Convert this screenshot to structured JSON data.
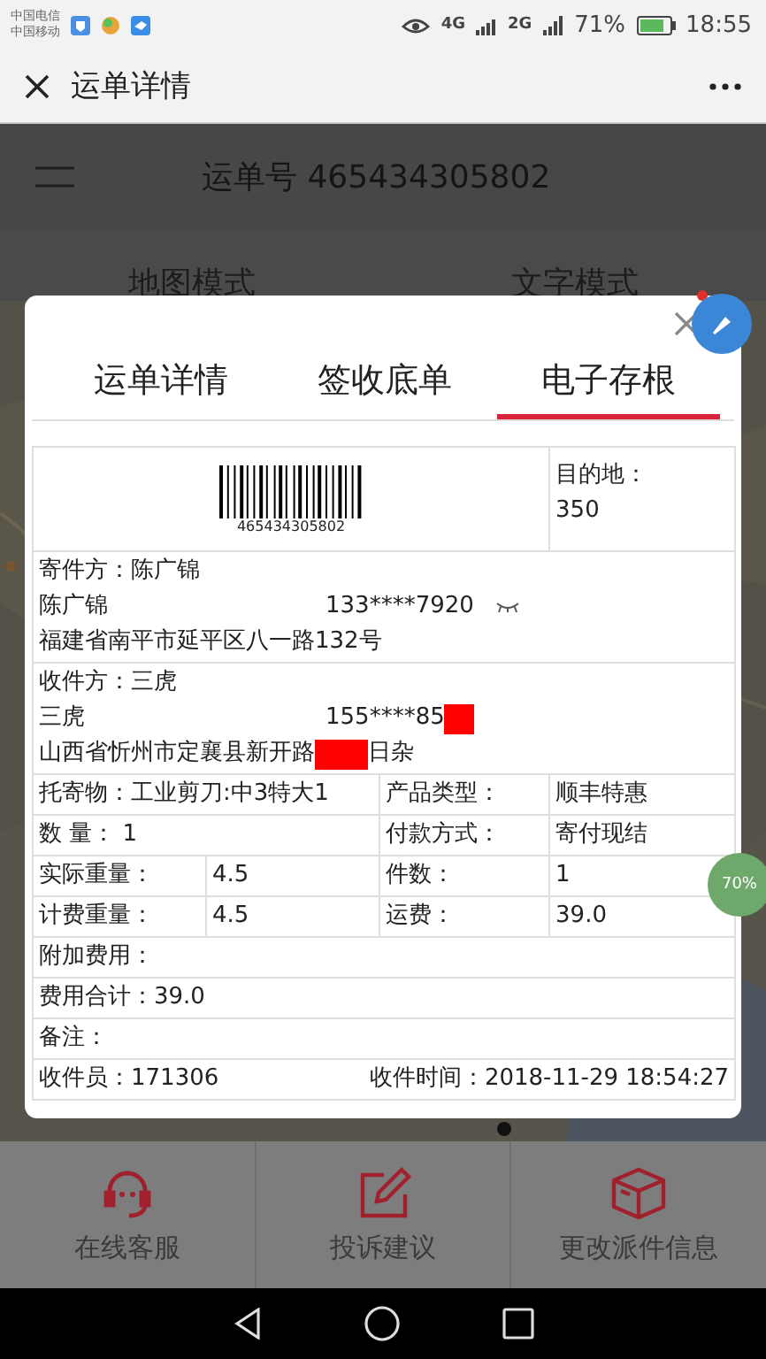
{
  "status_bar": {
    "carriers": [
      "中国电信",
      "中国移动"
    ],
    "network": [
      "4G",
      "2G"
    ],
    "battery": "71%",
    "time": "18:55"
  },
  "title_bar": {
    "title": "运单详情"
  },
  "header": {
    "title": "运单号 465434305802"
  },
  "mode_tabs": [
    {
      "label": "地图模式"
    },
    {
      "label": "文字模式"
    }
  ],
  "dialog": {
    "tabs": [
      {
        "label": "运单详情",
        "selected": false
      },
      {
        "label": "签收底单",
        "selected": false
      },
      {
        "label": "电子存根",
        "selected": true
      }
    ],
    "barcode_number": "465434305802",
    "destination": {
      "label": "目的地：",
      "value": "350"
    },
    "sender": {
      "label": "寄件方：陈广锦",
      "name": "陈广锦",
      "phone": "133****7920",
      "address": "福建省南平市延平区八一路132号"
    },
    "receiver": {
      "label": "收件方：三虎",
      "name": "三虎",
      "phone": "155****85",
      "phone_redacted": true,
      "address_segments": [
        "山西省忻州市定襄县新开路",
        "日杂"
      ]
    },
    "grid_rows": [
      {
        "kind": "merged",
        "cells": [
          "托寄物：工业剪刀:中3特大1",
          "产品类型：",
          "顺丰特惠"
        ]
      },
      {
        "kind": "merged",
        "cells": [
          "数 量： 1",
          "付款方式：",
          "寄付现结"
        ]
      },
      {
        "kind": "split",
        "cells": [
          "实际重量：",
          "4.5",
          "件数：",
          "1"
        ]
      },
      {
        "kind": "split",
        "cells": [
          "计费重量：",
          "4.5",
          "运费：",
          "39.0"
        ]
      }
    ],
    "summary_rows": [
      "附加费用：",
      "费用合计：39.0",
      "备注："
    ],
    "footer": {
      "collector": "收件员：171306",
      "time": "收件时间：2018-11-29 18:54:27"
    }
  },
  "float_badge": "70%",
  "actions": [
    {
      "label": "在线客服"
    },
    {
      "label": "投诉建议"
    },
    {
      "label": "更改派件信息"
    }
  ]
}
